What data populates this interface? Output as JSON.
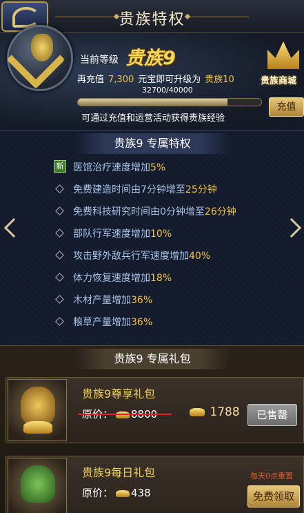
{
  "header": {
    "title": "贵族特权"
  },
  "status": {
    "current_level_label": "当前等级",
    "current_level_name": "贵族9",
    "upgrade": {
      "prefix": "再充值",
      "amount": "7,300",
      "middle": "元宝即可升级为",
      "next_level": "贵族10"
    },
    "progress_text": "32700/40000",
    "progress_fraction": 0.8175,
    "hint": "可通过充值和运营活动获得贵族经验",
    "recharge_label": "充值",
    "shop_label": "贵族商城"
  },
  "privileges": {
    "title": "贵族9  专属特权",
    "new_badge": "新",
    "items": [
      {
        "text": "医馆治疗速度增加",
        "value": "5%"
      },
      {
        "text": "免费建造时间由7分钟增至",
        "value": "25分钟"
      },
      {
        "text": "免费科技研究时间由0分钟增至",
        "value": "26分钟"
      },
      {
        "text": "部队行军速度增加",
        "value": "10%"
      },
      {
        "text": "攻击野外敌兵行军速度增加",
        "value": "40%"
      },
      {
        "text": "体力恢复速度增加",
        "value": "18%"
      },
      {
        "text": "木材产量增加",
        "value": "36%"
      },
      {
        "text": "粮草产量增加",
        "value": "36%"
      }
    ]
  },
  "gifts": {
    "title": "贵族9  专属礼包",
    "items": [
      {
        "name": "贵族9尊享礼包",
        "price_label": "原价：",
        "orig_price": "8800",
        "new_price": "1788",
        "button": "已售罄"
      },
      {
        "name": "贵族9每日礼包",
        "price_label": "原价：",
        "orig_price": "438",
        "note": "每天0点重置",
        "button": "免费领取"
      }
    ]
  }
}
